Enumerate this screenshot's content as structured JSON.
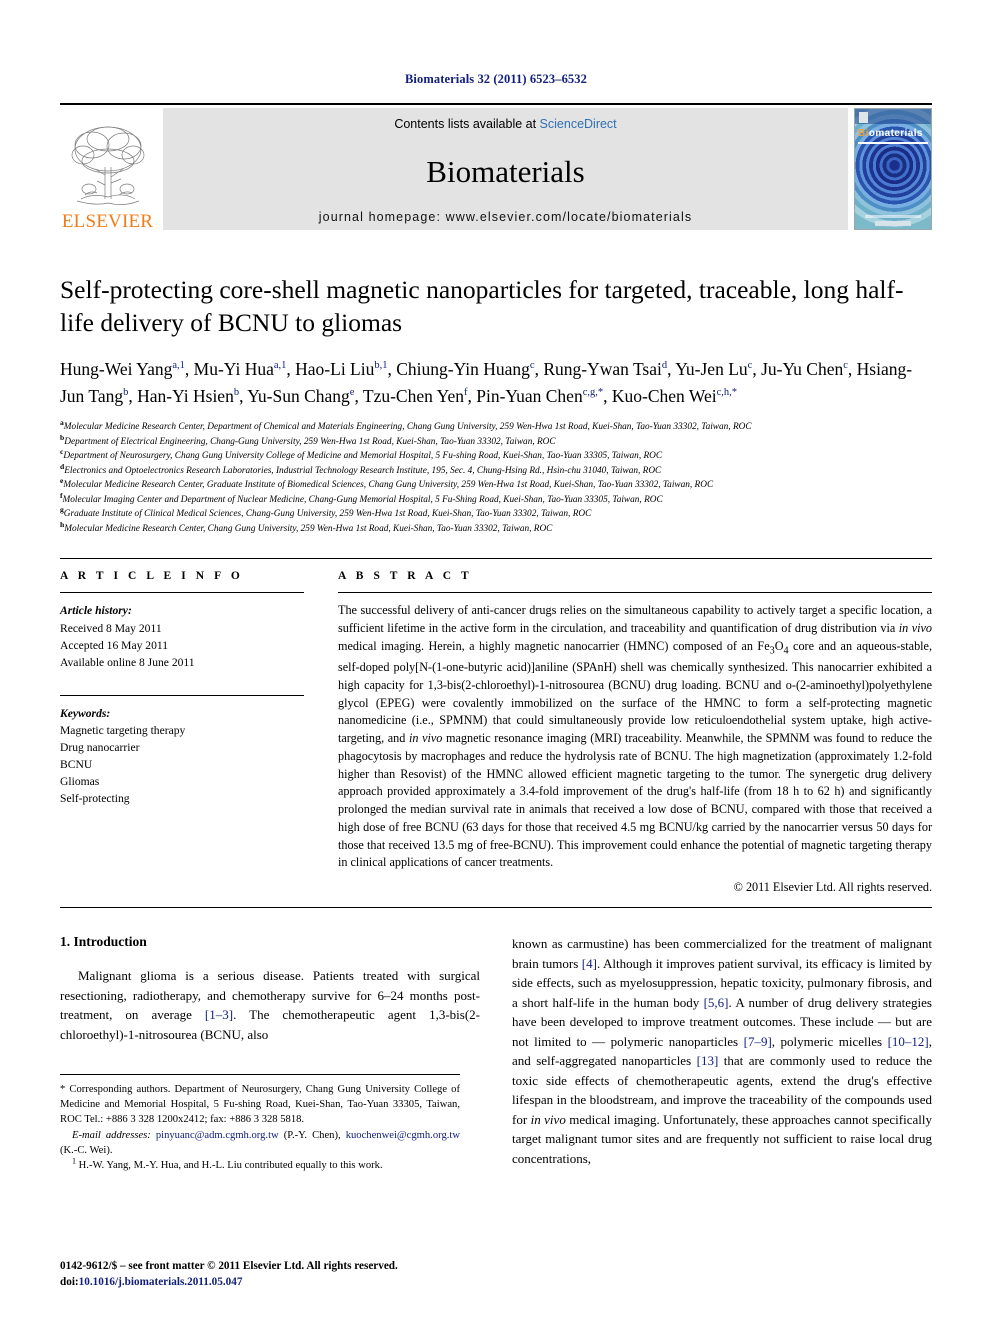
{
  "running_head": "Biomaterials 32 (2011) 6523–6532",
  "masthead": {
    "contents_prefix": "Contents lists available at ",
    "sciencedirect": "ScienceDirect",
    "journal_name": "Biomaterials",
    "homepage_label": "journal homepage: www.elsevier.com/locate/biomaterials",
    "publisher": "ELSEVIER",
    "cover_title_first": "Bi",
    "cover_title_rest": "omaterials",
    "accent_orange": "#f07d1a",
    "link_blue": "#2f6fb4",
    "heading_navy": "#12207a"
  },
  "article": {
    "title": "Self-protecting core-shell magnetic nanoparticles for targeted, traceable, long half-life delivery of BCNU to gliomas",
    "authors": [
      {
        "name": "Hung-Wei Yang",
        "sup": "a,1",
        "sep": ", "
      },
      {
        "name": "Mu-Yi Hua",
        "sup": "a,1",
        "sep": ", "
      },
      {
        "name": "Hao-Li Liu",
        "sup": "b,1",
        "sep": ", "
      },
      {
        "name": "Chiung-Yin Huang",
        "sup": "c",
        "sep": ", "
      },
      {
        "name": "Rung-Ywan Tsai",
        "sup": "d",
        "sep": ", "
      },
      {
        "name": "Yu-Jen Lu",
        "sup": "c",
        "sep": ", "
      },
      {
        "name": "Ju-Yu Chen",
        "sup": "c",
        "sep": ", "
      },
      {
        "name": "Hsiang-Jun Tang",
        "sup": "b",
        "sep": ", "
      },
      {
        "name": "Han-Yi Hsien",
        "sup": "b",
        "sep": ", "
      },
      {
        "name": "Yu-Sun Chang",
        "sup": "e",
        "sep": ", "
      },
      {
        "name": "Tzu-Chen Yen",
        "sup": "f",
        "sep": ", "
      },
      {
        "name": "Pin-Yuan Chen",
        "sup": "c,g,*",
        "sep": ", "
      },
      {
        "name": "Kuo-Chen Wei",
        "sup": "c,h,*",
        "sep": ""
      }
    ],
    "affiliations": [
      {
        "mark": "a",
        "text": "Molecular Medicine Research Center, Department of Chemical and Materials Engineering, Chang Gung University, 259 Wen-Hwa 1st Road, Kuei-Shan, Tao-Yuan 33302, Taiwan, ROC"
      },
      {
        "mark": "b",
        "text": "Department of Electrical Engineering, Chang-Gung University, 259 Wen-Hwa 1st Road, Kuei-Shan, Tao-Yuan 33302, Taiwan, ROC"
      },
      {
        "mark": "c",
        "text": "Department of Neurosurgery, Chang Gung University College of Medicine and Memorial Hospital, 5 Fu-shing Road, Kuei-Shan, Tao-Yuan 33305, Taiwan, ROC"
      },
      {
        "mark": "d",
        "text": "Electronics and Optoelectronics Research Laboratories, Industrial Technology Research Institute, 195, Sec. 4, Chung-Hsing Rd., Hsin-chu 31040, Taiwan, ROC"
      },
      {
        "mark": "e",
        "text": "Molecular Medicine Research Center, Graduate Institute of Biomedical Sciences, Chang Gung University, 259 Wen-Hwa 1st Road, Kuei-Shan, Tao-Yuan 33302, Taiwan, ROC"
      },
      {
        "mark": "f",
        "text": "Molecular Imaging Center and Department of Nuclear Medicine, Chang-Gung Memorial Hospital, 5 Fu-Shing Road, Kuei-Shan, Tao-Yuan 33305, Taiwan, ROC"
      },
      {
        "mark": "g",
        "text": "Graduate Institute of Clinical Medical Sciences, Chang-Gung University, 259 Wen-Hwa 1st Road, Kuei-Shan, Tao-Yuan 33302, Taiwan, ROC"
      },
      {
        "mark": "h",
        "text": "Molecular Medicine Research Center, Chang Gung University, 259 Wen-Hwa 1st Road, Kuei-Shan, Tao-Yuan 33302, Taiwan, ROC"
      }
    ]
  },
  "article_info": {
    "heading": "A R T I C L E    I N F O",
    "history_label": "Article history:",
    "history": [
      "Received 8 May 2011",
      "Accepted 16 May 2011",
      "Available online 8 June 2011"
    ],
    "keywords_label": "Keywords:",
    "keywords": [
      "Magnetic targeting therapy",
      "Drug nanocarrier",
      "BCNU",
      "Gliomas",
      "Self-protecting"
    ]
  },
  "abstract": {
    "heading": "A B S T R A C T",
    "copyright": "© 2011 Elsevier Ltd. All rights reserved.",
    "paragraph_parts": {
      "p1": "The successful delivery of anti-cancer drugs relies on the simultaneous capability to actively target a specific location, a sufficient lifetime in the active form in the circulation, and traceability and quantification of drug distribution via ",
      "it1": "in vivo",
      "p2": " medical imaging. Herein, a highly magnetic nanocarrier (HMNC) composed of an Fe",
      "sub1": "3",
      "p3": "O",
      "sub2": "4",
      "p4": " core and an aqueous-stable, self-doped poly[N-(1-one-butyric acid)]aniline (SPAnH) shell was chemically synthesized. This nanocarrier exhibited a high capacity for 1,3-bis(2-chloroethyl)-1-nitrosourea (BCNU) drug loading. BCNU and o-(2-aminoethyl)polyethylene glycol (EPEG) were covalently immobilized on the surface of the HMNC to form a self-protecting magnetic nanomedicine (i.e., SPMNM) that could simultaneously provide low reticuloendothelial system uptake, high active-targeting, and ",
      "it2": "in vivo",
      "p5": " magnetic resonance imaging (MRI) traceability. Meanwhile, the SPMNM was found to reduce the phagocytosis by macrophages and reduce the hydrolysis rate of BCNU. The high magnetization (approximately 1.2-fold higher than Resovist) of the HMNC allowed efficient magnetic targeting to the tumor. The synergetic drug delivery approach provided approximately a 3.4-fold improvement of the drug's half-life (from 18 h to 62 h) and significantly prolonged the median survival rate in animals that received a low dose of BCNU, compared with those that received a high dose of free BCNU (63 days for those that received 4.5 mg BCNU/kg carried by the nanocarrier versus 50 days for those that received 13.5 mg of free-BCNU). This improvement could enhance the potential of magnetic targeting therapy in clinical applications of cancer treatments."
    }
  },
  "introduction": {
    "heading": "1.  Introduction",
    "left_p1_a": "Malignant glioma is a serious disease. Patients treated with surgical resectioning, radiotherapy, and chemotherapy survive for 6–24 months post-treatment, on average ",
    "left_ref1": "[1–3]",
    "left_p1_b": ". The chemotherapeutic agent 1,3-bis(2-chloroethyl)-1-nitrosourea (BCNU, also",
    "right_p1_a": "known as carmustine) has been commercialized for the treatment of malignant brain tumors ",
    "right_ref1": "[4]",
    "right_p1_b": ". Although it improves patient survival, its efficacy is limited by side effects, such as myelosuppression, hepatic toxicity, pulmonary fibrosis, and a short half-life in the human body ",
    "right_ref2": "[5,6]",
    "right_p1_c": ". A number of drug delivery strategies have been developed to improve treatment outcomes. These include — but are not limited to — polymeric nanoparticles ",
    "right_ref3": "[7–9]",
    "right_p1_d": ", polymeric micelles ",
    "right_ref4": "[10–12]",
    "right_p1_e": ", and self-aggregated nanoparticles ",
    "right_ref5": "[13]",
    "right_p1_f": " that are commonly used to reduce the toxic side effects of chemotherapeutic agents, extend the drug's effective lifespan in the bloodstream, and improve the traceability of the compounds used for ",
    "right_it1": "in vivo",
    "right_p1_g": " medical imaging. Unfortunately, these approaches cannot specifically target malignant tumor sites and are frequently not sufficient to raise local drug concentrations,"
  },
  "footnotes": {
    "corresponding": "* Corresponding authors. Department of Neurosurgery, Chang Gung University College of Medicine and Memorial Hospital, 5 Fu-shing Road, Kuei-Shan, Tao-Yuan 33305, Taiwan, ROC Tel.: +886 3 328 1200x2412; fax: +886 3 328 5818.",
    "email_label": "E-mail addresses:",
    "email1": "pinyuanc@adm.cgmh.org.tw",
    "email1_owner": " (P.-Y. Chen), ",
    "email2": "kuochenwei@cgmh.org.tw",
    "email2_owner": " (K.-C. Wei).",
    "equal_mark": "1",
    "equal_contrib": "H.-W. Yang, M.-Y. Hua, and H.-L. Liu contributed equally to this work."
  },
  "footer": {
    "issn_line": "0142-9612/$ – see front matter © 2011 Elsevier Ltd. All rights reserved.",
    "doi_label": "doi:",
    "doi_value": "10.1016/j.biomaterials.2011.05.047"
  }
}
